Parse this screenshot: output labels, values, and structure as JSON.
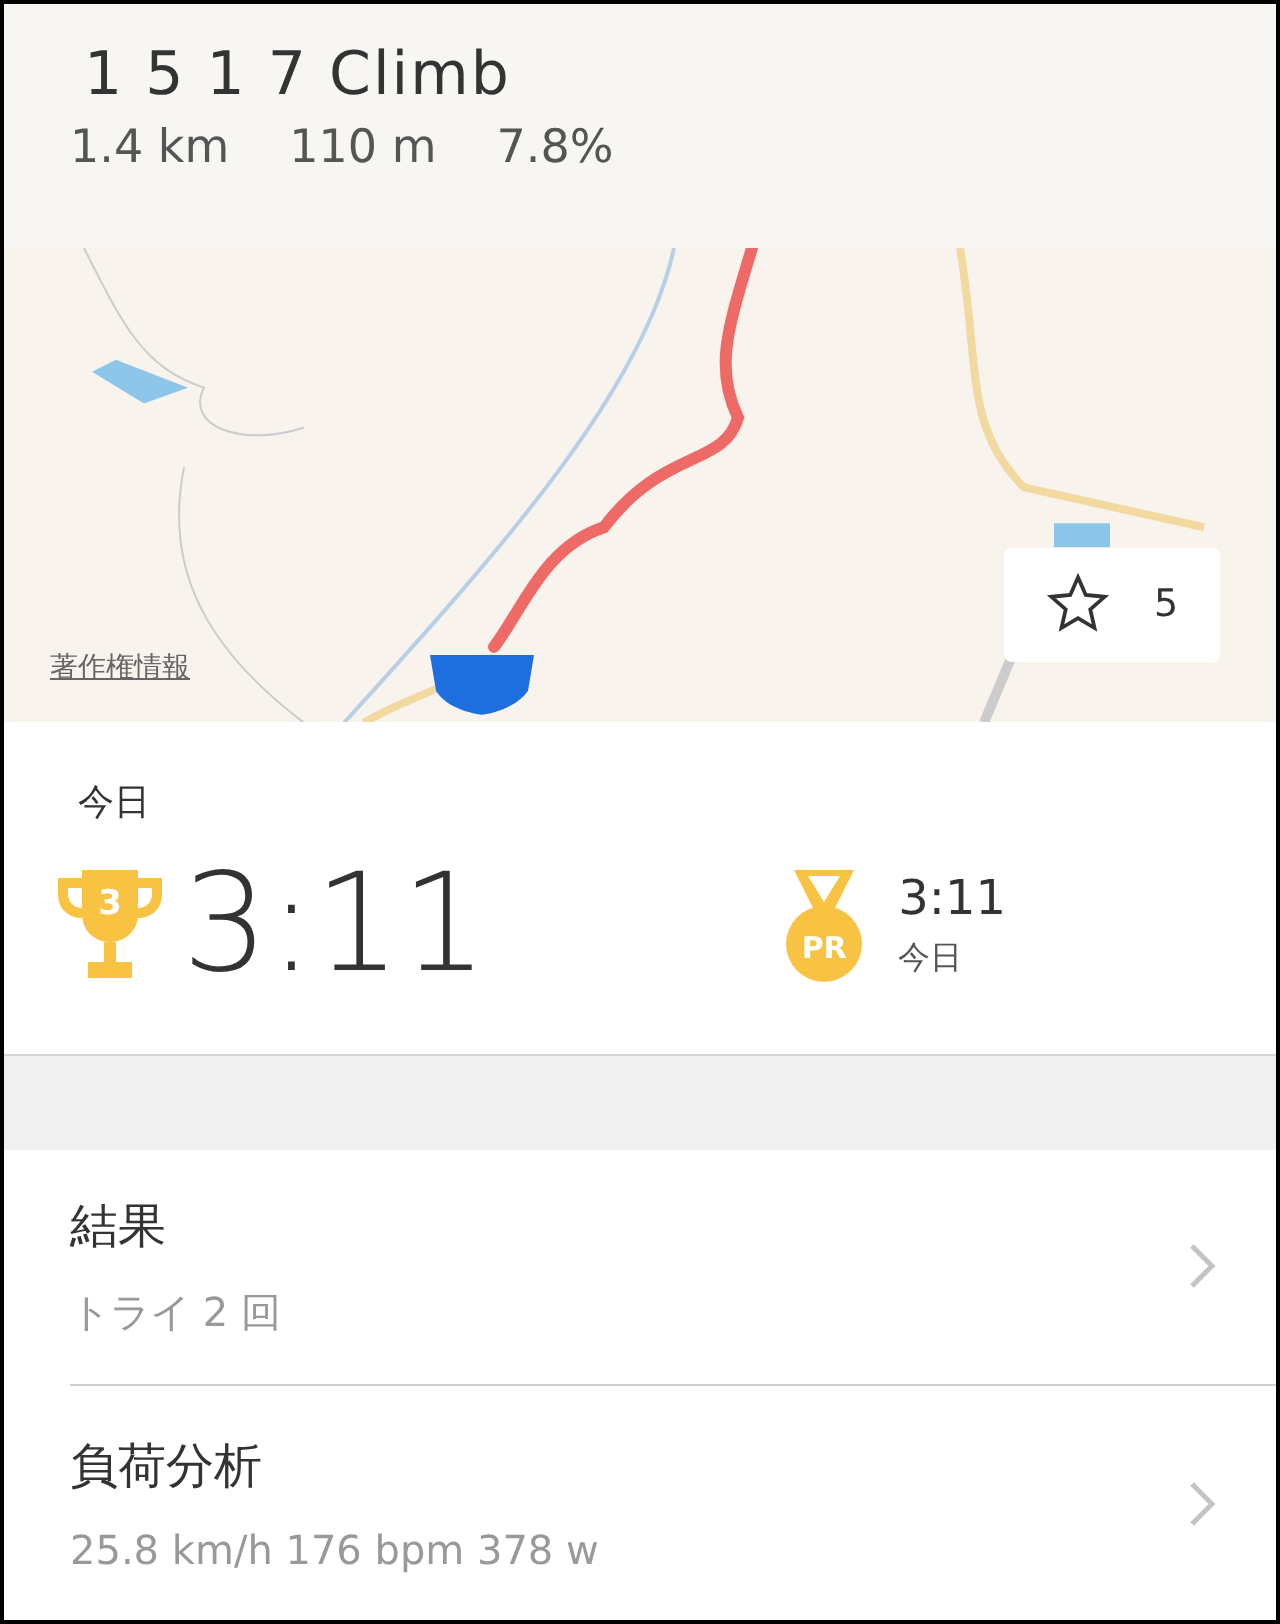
{
  "header": {
    "title": "1 5 1 7 Climb",
    "stats": [
      "1.4 km",
      "110 m",
      "7.8%"
    ]
  },
  "map": {
    "kind": "picture",
    "copyright_link": "著作権情報",
    "star_button": {
      "count": "5"
    }
  },
  "today": {
    "label": "今日",
    "rank": "3",
    "time": "3:11",
    "pr": {
      "badge": "PR",
      "time": "3:11",
      "date": "今日"
    }
  },
  "rows": [
    {
      "title": "結果",
      "subtitle": "トライ 2 回"
    },
    {
      "title": "負荷分析",
      "subtitle": "25.8 km/h 176 bpm 378 w"
    }
  ]
}
